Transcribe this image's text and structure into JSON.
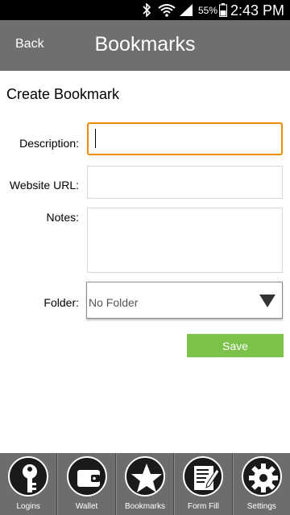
{
  "status_bar": {
    "battery_percent": "55%",
    "time": "2:43 PM",
    "icons": [
      "bluetooth-icon",
      "wifi-icon",
      "cell-signal-icon",
      "battery-icon"
    ]
  },
  "header": {
    "back_label": "Back",
    "title": "Bookmarks"
  },
  "form": {
    "heading": "Create Bookmark",
    "description": {
      "label": "Description:",
      "value": ""
    },
    "website_url": {
      "label": "Website URL:",
      "value": ""
    },
    "notes": {
      "label": "Notes:",
      "value": ""
    },
    "folder": {
      "label": "Folder:",
      "selected": "No Folder"
    },
    "save_label": "Save"
  },
  "bottom_nav": {
    "items": [
      {
        "label": "Logins",
        "icon": "key-icon"
      },
      {
        "label": "Wallet",
        "icon": "wallet-icon"
      },
      {
        "label": "Bookmarks",
        "icon": "star-icon"
      },
      {
        "label": "Form Fill",
        "icon": "form-fill-icon"
      },
      {
        "label": "Settings",
        "icon": "gear-icon"
      }
    ]
  },
  "colors": {
    "header_bg": "#6f6f6f",
    "focus_border": "#f08c00",
    "save_button_bg": "#7bc24a",
    "nav_bg": "#6d6d6d"
  }
}
